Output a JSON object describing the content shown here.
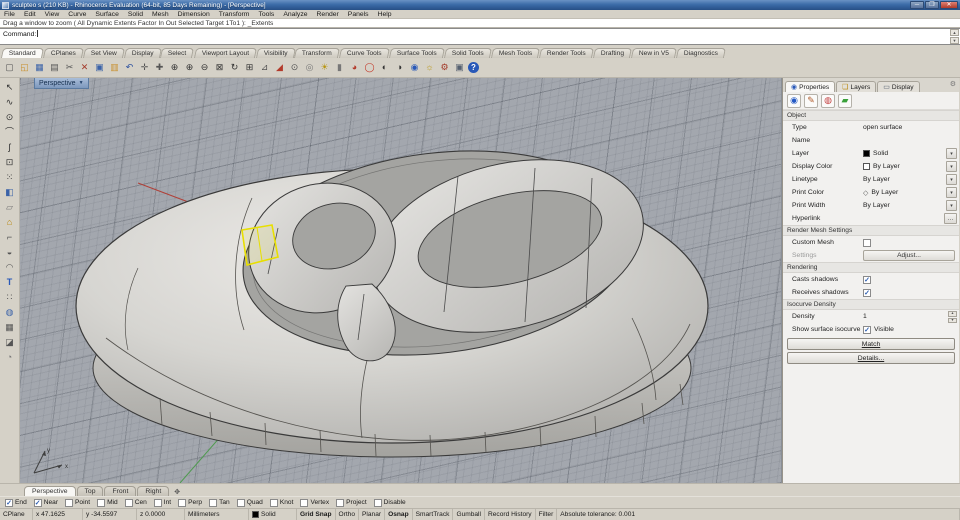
{
  "titlebar": {
    "title": "sculpteo s (210 KB) - Rhinoceros Evaluation (64-bit, 85 Days Remaining) - [Perspective]"
  },
  "menu": {
    "items": [
      "File",
      "Edit",
      "View",
      "Curve",
      "Surface",
      "Solid",
      "Mesh",
      "Dimension",
      "Transform",
      "Tools",
      "Analyze",
      "Render",
      "Panels",
      "Help"
    ]
  },
  "command": {
    "history": "Drag a window to zoom ( All  Dynamic  Extents  Factor  In  Out  Selected  Target  1To1 ):  _Extents",
    "prompt": "Command:"
  },
  "toolbar_tabs": {
    "active": "Standard",
    "items": [
      "Standard",
      "CPlanes",
      "Set View",
      "Display",
      "Select",
      "Viewport Layout",
      "Visibility",
      "Transform",
      "Curve Tools",
      "Surface Tools",
      "Solid Tools",
      "Mesh Tools",
      "Render Tools",
      "Drafting",
      "New in V5",
      "Diagnostics"
    ]
  },
  "toolbar_icons": [
    {
      "name": "new-file",
      "glyph": "▢",
      "color": "#555"
    },
    {
      "name": "open-file",
      "glyph": "◱",
      "color": "#c8902f"
    },
    {
      "name": "save",
      "glyph": "▦",
      "color": "#3a62a8"
    },
    {
      "name": "print",
      "glyph": "▤",
      "color": "#555"
    },
    {
      "name": "cut",
      "glyph": "✂",
      "color": "#555"
    },
    {
      "name": "delete",
      "glyph": "✕",
      "color": "#a33a2a"
    },
    {
      "name": "copy",
      "glyph": "▣",
      "color": "#3a62a8"
    },
    {
      "name": "paste",
      "glyph": "▥",
      "color": "#c8902f"
    },
    {
      "name": "undo",
      "glyph": "↶",
      "color": "#2a4f9e"
    },
    {
      "name": "pan",
      "glyph": "✛",
      "color": "#555"
    },
    {
      "name": "move",
      "glyph": "✚",
      "color": "#555"
    },
    {
      "name": "zoom-dynamic",
      "glyph": "⊕",
      "color": "#333"
    },
    {
      "name": "zoom-window",
      "glyph": "⊕",
      "color": "#333"
    },
    {
      "name": "zoom-selected",
      "glyph": "⊖",
      "color": "#333"
    },
    {
      "name": "zoom-extents",
      "glyph": "⊠",
      "color": "#333"
    },
    {
      "name": "rotate-view",
      "glyph": "↻",
      "color": "#333"
    },
    {
      "name": "viewport-layout",
      "glyph": "⊞",
      "color": "#333"
    },
    {
      "name": "cplane",
      "glyph": "⊿",
      "color": "#555"
    },
    {
      "name": "layer-state",
      "glyph": "◢",
      "color": "#b33a2a"
    },
    {
      "name": "object-snap",
      "glyph": "⊙",
      "color": "#555"
    },
    {
      "name": "record",
      "glyph": "◎",
      "color": "#777"
    },
    {
      "name": "light",
      "glyph": "☀",
      "color": "#b8950f"
    },
    {
      "name": "lock",
      "glyph": "▮",
      "color": "#777"
    },
    {
      "name": "shaded-display",
      "glyph": "◕",
      "color": "#b33a2a"
    },
    {
      "name": "render",
      "glyph": "◯",
      "color": "#c33a2a"
    },
    {
      "name": "render-preview",
      "glyph": "◐",
      "color": "#333"
    },
    {
      "name": "render-preview-window",
      "glyph": "◑",
      "color": "#333"
    },
    {
      "name": "render-settings",
      "glyph": "◉",
      "color": "#2858b8"
    },
    {
      "name": "sun",
      "glyph": "☼",
      "color": "#b8950f"
    },
    {
      "name": "options-gear",
      "glyph": "⚙",
      "color": "#a33a2a"
    },
    {
      "name": "display-box",
      "glyph": "▣",
      "color": "#556070"
    },
    {
      "name": "help",
      "glyph": "?",
      "color": "#ffffff"
    }
  ],
  "left_toolbar_icons": [
    {
      "name": "select-arrow",
      "glyph": "↖",
      "color": "#333"
    },
    {
      "name": "curve-polyline",
      "glyph": "∿",
      "color": "#333"
    },
    {
      "name": "circle-tool",
      "glyph": "⊙",
      "color": "#333"
    },
    {
      "name": "arc-tool",
      "glyph": "⌒",
      "color": "#333"
    },
    {
      "name": "freeform-curve",
      "glyph": "ʃ",
      "color": "#333"
    },
    {
      "name": "point-tool",
      "glyph": "⊡",
      "color": "#333"
    },
    {
      "name": "control-points",
      "glyph": "⁙",
      "color": "#333"
    },
    {
      "name": "solid-box",
      "glyph": "◧",
      "color": "#3a62a8"
    },
    {
      "name": "surface-tool",
      "glyph": "▱",
      "color": "#777"
    },
    {
      "name": "polygon-tool",
      "glyph": "⌂",
      "color": "#b8860b"
    },
    {
      "name": "joint-tool",
      "glyph": "⌐",
      "color": "#555"
    },
    {
      "name": "solid-union",
      "glyph": "◒",
      "color": "#555"
    },
    {
      "name": "arc-blend",
      "glyph": "◠",
      "color": "#555"
    },
    {
      "name": "text-tool",
      "glyph": "T",
      "color": "#2858b8"
    },
    {
      "name": "array-tool",
      "glyph": "∷",
      "color": "#555"
    },
    {
      "name": "sphere-tool",
      "glyph": "◍",
      "color": "#3a62a8"
    },
    {
      "name": "mesh-tool",
      "glyph": "▦",
      "color": "#555"
    },
    {
      "name": "trim-tool",
      "glyph": "◪",
      "color": "#555"
    },
    {
      "name": "circle-deform",
      "glyph": "◔",
      "color": "#777"
    }
  ],
  "viewport": {
    "label": "Perspective",
    "axis_x": "x",
    "axis_y": "y"
  },
  "panel": {
    "tabs": [
      {
        "label": "Properties",
        "icon": "◉",
        "icon_color": "#2858b8"
      },
      {
        "label": "Layers",
        "icon": "❏",
        "icon_color": "#b8860b"
      },
      {
        "label": "Display",
        "icon": "▭",
        "icon_color": "#556070"
      }
    ],
    "view_icons": [
      {
        "name": "object-properties",
        "glyph": "◉",
        "color": "#2358c4"
      },
      {
        "name": "material",
        "glyph": "✎",
        "color": "#b05a2a"
      },
      {
        "name": "texture-mapping",
        "glyph": "◍",
        "color": "#c23b3b"
      },
      {
        "name": "decal",
        "glyph": "▰",
        "color": "#3aa13a"
      }
    ],
    "object": {
      "header": "Object",
      "rows": [
        {
          "label": "Type",
          "value": "open surface"
        },
        {
          "label": "Name",
          "value": ""
        },
        {
          "label": "Layer",
          "value": "Solid"
        },
        {
          "label": "Display Color",
          "value": "By Layer"
        },
        {
          "label": "Linetype",
          "value": "By Layer"
        },
        {
          "label": "Print Color",
          "value": "By Layer"
        },
        {
          "label": "Print Width",
          "value": "By Layer"
        },
        {
          "label": "Hyperlink",
          "value": ""
        }
      ]
    },
    "render_mesh": {
      "header": "Render Mesh Settings",
      "custom_mesh": "Custom Mesh",
      "settings": "Settings",
      "adjust": "Adjust..."
    },
    "rendering": {
      "header": "Rendering",
      "casts": "Casts shadows",
      "receives": "Receives shadows"
    },
    "isocurve": {
      "header": "Isocurve Density",
      "density_label": "Density",
      "density_value": "1",
      "show_label": "Show surface isocurve",
      "visible": "Visible"
    },
    "buttons": {
      "match": "Match",
      "details": "Details..."
    }
  },
  "viewport_tabs": {
    "active": "Perspective",
    "items": [
      "Perspective",
      "Top",
      "Front",
      "Right"
    ]
  },
  "osnap": {
    "items": [
      {
        "label": "End",
        "checked": true
      },
      {
        "label": "Near",
        "checked": true
      },
      {
        "label": "Point",
        "checked": false
      },
      {
        "label": "Mid",
        "checked": false
      },
      {
        "label": "Cen",
        "checked": false
      },
      {
        "label": "Int",
        "checked": false
      },
      {
        "label": "Perp",
        "checked": false
      },
      {
        "label": "Tan",
        "checked": false
      },
      {
        "label": "Quad",
        "checked": false
      },
      {
        "label": "Knot",
        "checked": false
      },
      {
        "label": "Vertex",
        "checked": false
      },
      {
        "label": "Project",
        "checked": false
      },
      {
        "label": "Disable",
        "checked": false
      }
    ]
  },
  "statusbar": {
    "cplane": "CPlane",
    "x": "x 47.1625",
    "y": "y -34.5597",
    "z": "z 0.0000",
    "units": "Millimeters",
    "layer": "Solid",
    "toggles": [
      {
        "label": "Grid Snap",
        "active": true
      },
      {
        "label": "Ortho",
        "active": false
      },
      {
        "label": "Planar",
        "active": false
      },
      {
        "label": "Osnap",
        "active": true
      },
      {
        "label": "SmartTrack",
        "active": false
      },
      {
        "label": "Gumball",
        "active": false
      },
      {
        "label": "Record History",
        "active": false
      },
      {
        "label": "Filter",
        "active": false
      }
    ],
    "tolerance": "Absolute tolerance: 0.001"
  },
  "colors": {
    "titlebar": "#3c6ca8",
    "selection_highlight": "#e8df00",
    "axis_x_red": "#b04038",
    "axis_y_green": "#4f9a4f",
    "viewport_bg": "#a3a7ae"
  }
}
